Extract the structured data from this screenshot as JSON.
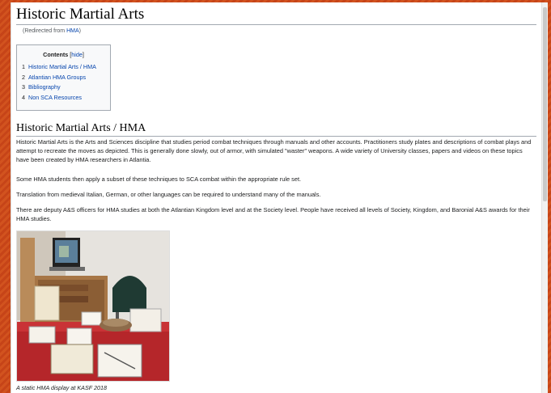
{
  "article": {
    "title": "Historic Martial Arts",
    "redirect_prefix": "(Redirected from ",
    "redirect_link": "HMA",
    "redirect_suffix": ")"
  },
  "toc": {
    "title": "Contents",
    "toggle_open": "[",
    "toggle_label": "hide",
    "toggle_close": "]",
    "items": [
      {
        "num": "1",
        "label": "Historic Martial Arts / HMA"
      },
      {
        "num": "2",
        "label": "Atlantian HMA Groups"
      },
      {
        "num": "3",
        "label": "Bibliography"
      },
      {
        "num": "4",
        "label": "Non SCA Resources"
      }
    ]
  },
  "section": {
    "heading": "Historic Martial Arts / HMA",
    "paragraphs": [
      "Historic Martial Arts is the Arts and Sciences discipline that studies period combat techniques through manuals and other accounts. Practitioners study plates and descriptions of combat plays and attempt to recreate the moves as depicted. This is generally done slowly, out of armor, with simulated \"waster\" weapons. A wide variety of University classes, papers and videos on these topics have been created by HMA researchers in Atlantia.",
      "Some HMA students then apply a subset of these techniques to SCA combat within the appropriate rule set.",
      "Translation from medieval Italian, German, or other languages can be required to understand many of the manuals.",
      "There are deputy A&S officers for HMA studies at both the Atlantian Kingdom level and at the Society level. People have received all levels of Society, Kingdom, and Baronial A&S awards for their HMA studies."
    ],
    "figure_caption": "A static HMA display at KASF 2018"
  }
}
